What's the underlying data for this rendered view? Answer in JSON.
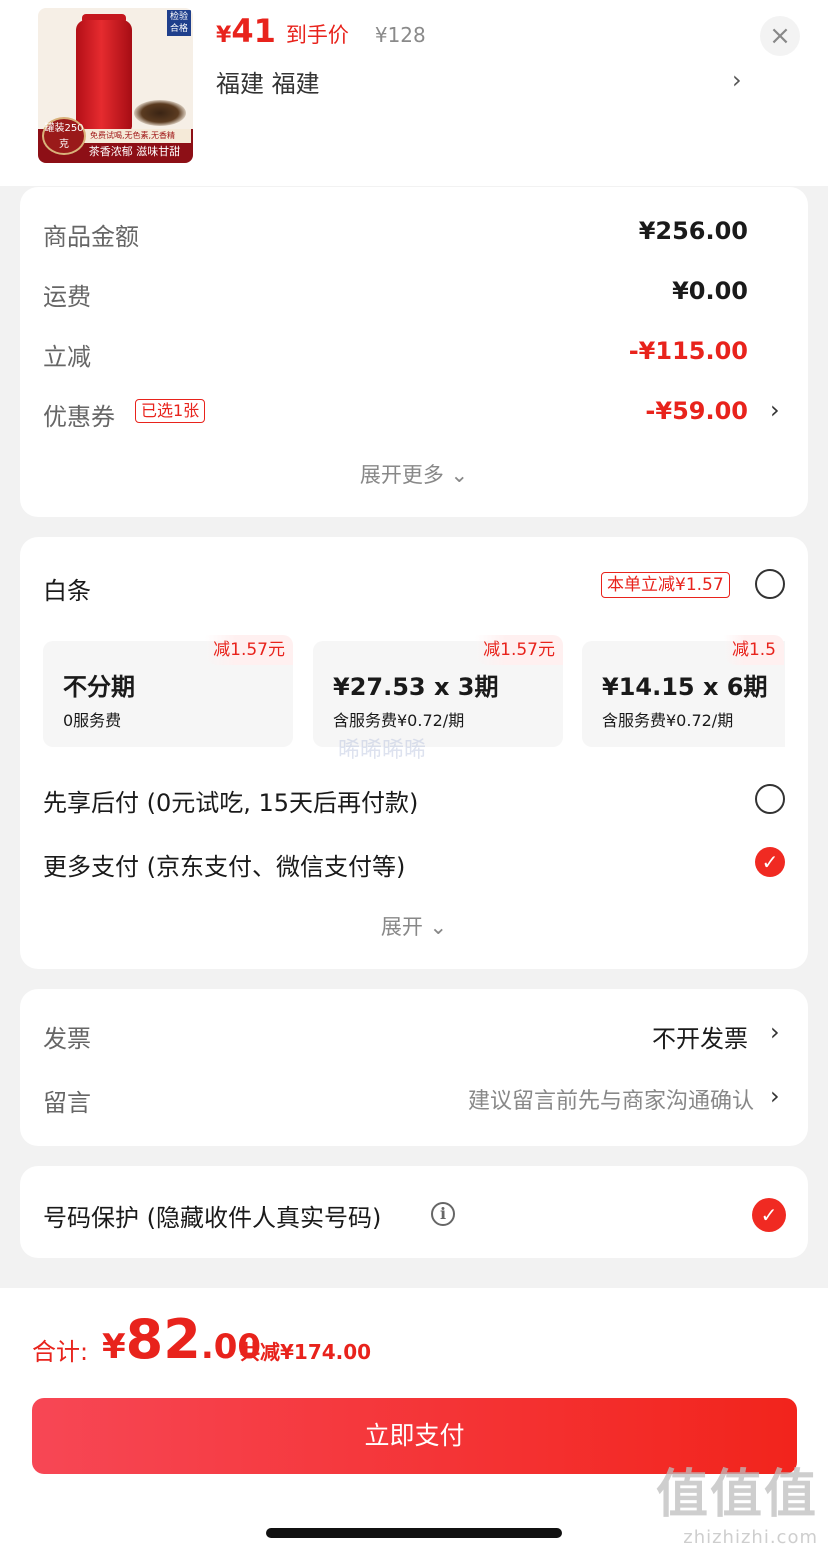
{
  "product": {
    "price_yen": "¥",
    "price_value": "41",
    "price_label": "到手价",
    "original_price": "¥128",
    "spec": "福建  福建",
    "spec_arrow": "›",
    "close_icon": "×",
    "image": {
      "cert_badge": "检验合格",
      "seal": "罐装250克",
      "band_top": "免费试喝,无色素,无香精",
      "band_main": "茶香浓郁 滋味甘甜"
    }
  },
  "summary": {
    "rows": [
      {
        "label": "商品金额",
        "value": "¥256.00"
      },
      {
        "label": "运费",
        "value": "¥0.00"
      },
      {
        "label": "立减",
        "value": "-¥115.00"
      },
      {
        "label": "优惠券",
        "tag": "已选1张",
        "value": "-¥59.00"
      }
    ],
    "expand_label": "展开更多 ⌄"
  },
  "payment": {
    "baitiao_label": "白条",
    "baitiao_badge": "本单立减¥1.57",
    "plans": [
      {
        "badge": "减1.57元",
        "main": "不分期",
        "sub": "0服务费"
      },
      {
        "badge": "减1.57元",
        "main": "¥27.53 x 3期",
        "sub": "含服务费¥0.72/期"
      },
      {
        "badge": "减1.5",
        "main": "¥14.15 x 6期",
        "sub": "含服务费¥0.72/期"
      }
    ],
    "overlay_text": "晞晞晞晞",
    "pay_later": "先享后付 (0元试吃, 15天后再付款)",
    "more_pay": "更多支付 (京东支付、微信支付等)",
    "expand_label": "展开 ⌄",
    "check_glyph": "✓"
  },
  "invoice": {
    "invoice_label": "发票",
    "invoice_value": "不开发票",
    "note_label": "留言",
    "note_placeholder": "建议留言前先与商家沟通确认"
  },
  "privacy": {
    "label": "号码保护 (隐藏收件人真实号码)",
    "info_glyph": "i"
  },
  "footer": {
    "total_label": "合计:",
    "total_yen": "¥",
    "total_int": "82",
    "total_dec": ".00",
    "saved": "共减¥174.00",
    "pay_button": "立即支付"
  },
  "watermark": {
    "big": "值值值",
    "small": "zhizhizhi.com"
  },
  "colors": {
    "accent": "#e8231c",
    "button_start": "#f74755",
    "button_end": "#f2241c"
  }
}
